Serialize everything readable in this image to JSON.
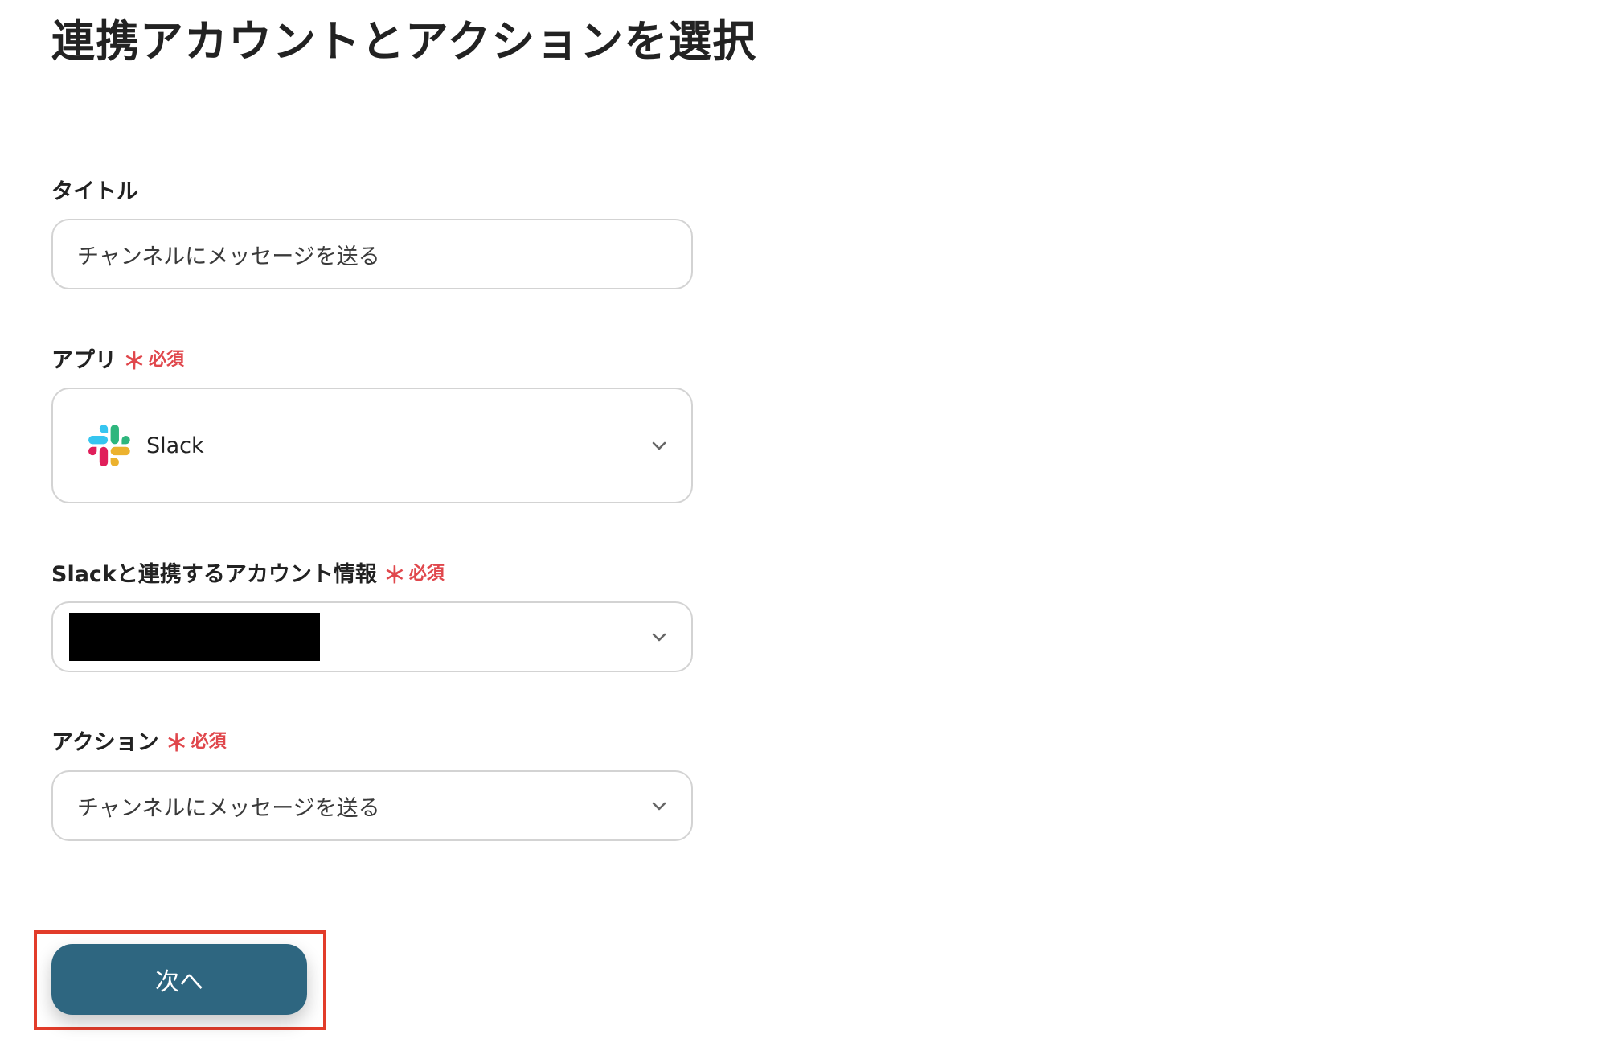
{
  "page": {
    "title": "連携アカウントとアクションを選択"
  },
  "form": {
    "title_field": {
      "label": "タイトル",
      "value": "チャンネルにメッセージを送る"
    },
    "app_field": {
      "label": "アプリ",
      "required_mark": "＊",
      "required_text": "必須",
      "value": "Slack",
      "icon": "slack-logo"
    },
    "account_field": {
      "label": "Slackと連携するアカウント情報",
      "required_mark": "＊",
      "required_text": "必須",
      "value_redacted": true
    },
    "action_field": {
      "label": "アクション",
      "required_mark": "＊",
      "required_text": "必須",
      "value": "チャンネルにメッセージを送る"
    }
  },
  "next_button": {
    "label": "次へ"
  },
  "colors": {
    "primary_button": "#2e6680",
    "required": "#e0474c",
    "highlight_frame": "#e23c2a",
    "input_border": "#d3d3d3"
  }
}
